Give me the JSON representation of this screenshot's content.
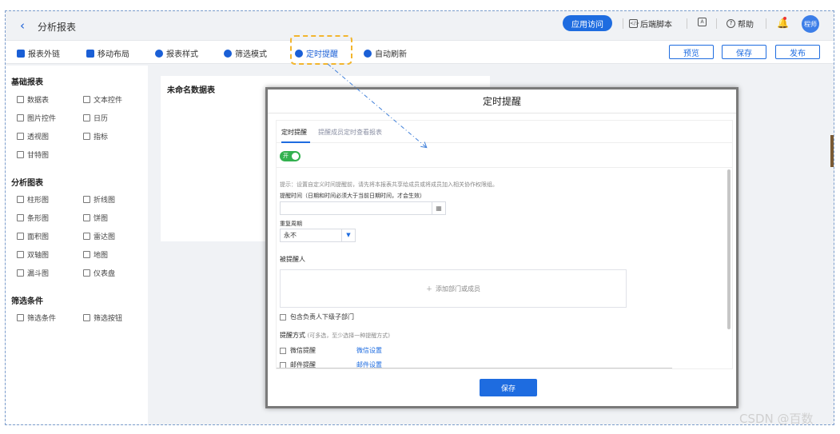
{
  "header": {
    "back_icon": "chevron-left-icon",
    "title": "分析报表",
    "apply_access": "应用访问",
    "backend_script": "后端脚本",
    "help": "帮助",
    "avatar_text": "程师"
  },
  "toolbar": {
    "items": [
      "报表外链",
      "移动布局",
      "报表样式",
      "筛选模式",
      "定时提醒",
      "自动刷新"
    ],
    "preview": "预览",
    "save": "保存",
    "publish": "发布"
  },
  "sidebar": {
    "basic_title": "基础报表",
    "basic_items": [
      "数据表",
      "文本控件",
      "图片控件",
      "日历",
      "透视图",
      "指标",
      "甘特图"
    ],
    "analysis_title": "分析图表",
    "analysis_items": [
      "柱形图",
      "折线图",
      "条形图",
      "饼图",
      "面积图",
      "雷达图",
      "双轴图",
      "地图",
      "漏斗图",
      "仪表盘"
    ],
    "filter_title": "筛选条件",
    "filter_items": [
      "筛选条件",
      "筛选按钮"
    ]
  },
  "canvas": {
    "sheet_title": "未命名数据表"
  },
  "modal": {
    "title": "定时提醒",
    "tab_active": "定时提醒",
    "tab_inactive": "提醒成员定时查看报表",
    "toggle_label": "开",
    "hint": "提示：设置自定义时间提醒前，请先将本报表共享给成员或将成员加入相关协作权限组。",
    "time_label": "提醒时间（日期和时间必须大于当前日期时间，才会生效）",
    "time_value": "",
    "repeat_label": "重复周期",
    "repeat_value": "永不",
    "recipients_label": "被提醒人",
    "add_members": "添加部门或成员",
    "include_sub": "包含负责人下级子部门",
    "method_label": "提醒方式",
    "method_hint": "(可多选，至少选择一种提醒方式)",
    "wechat": "微信提醒",
    "wechat_settings": "微信设置",
    "email": "邮件提醒",
    "email_settings": "邮件设置",
    "save": "保存"
  },
  "watermark": "CSDN @百数",
  "colors": {
    "accent": "#1e6ce0",
    "toggle_on": "#33b14f",
    "highlight": "#f2b52e"
  }
}
